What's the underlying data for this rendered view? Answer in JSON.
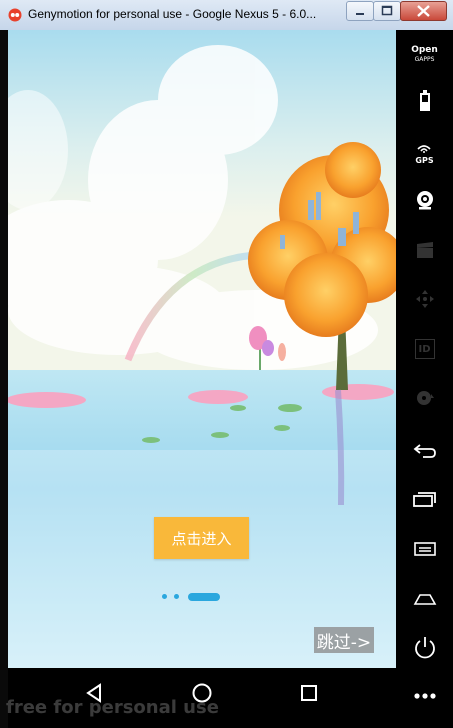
{
  "window": {
    "title": "Genymotion for personal use - Google Nexus 5 - 6.0...",
    "icon": "genymotion-logo-icon"
  },
  "sidebar": {
    "items": [
      {
        "name": "open-gapps",
        "label_line1": "Open",
        "label_line2": "GAPPS"
      },
      {
        "name": "battery",
        "icon": "battery-icon"
      },
      {
        "name": "gps",
        "label": "GPS",
        "icon": "gps-icon"
      },
      {
        "name": "webcam",
        "icon": "webcam-icon"
      },
      {
        "name": "media",
        "icon": "clapperboard-icon"
      },
      {
        "name": "dpad",
        "icon": "dpad-icon"
      },
      {
        "name": "id",
        "label": "ID",
        "icon": "id-icon"
      },
      {
        "name": "disk",
        "icon": "disk-icon"
      },
      {
        "name": "back",
        "icon": "back-arrow-icon"
      },
      {
        "name": "recents",
        "icon": "recent-apps-icon"
      },
      {
        "name": "menu",
        "icon": "menu-icon"
      },
      {
        "name": "home",
        "icon": "home-icon"
      },
      {
        "name": "power",
        "icon": "power-icon"
      },
      {
        "name": "more",
        "icon": "more-dots-icon"
      }
    ]
  },
  "app": {
    "enter_button": "点击进入",
    "skip_button": "跳过->",
    "page_indicator": {
      "pages": 3,
      "active": 3
    }
  },
  "android_nav": {
    "back": "back-triangle-icon",
    "home": "home-circle-icon",
    "recents": "recents-square-icon"
  },
  "watermark": "free for personal use",
  "colors": {
    "button_orange": "#f9b83a",
    "indicator_blue": "#2aa7de",
    "skip_gray": "#8c8c8c"
  }
}
